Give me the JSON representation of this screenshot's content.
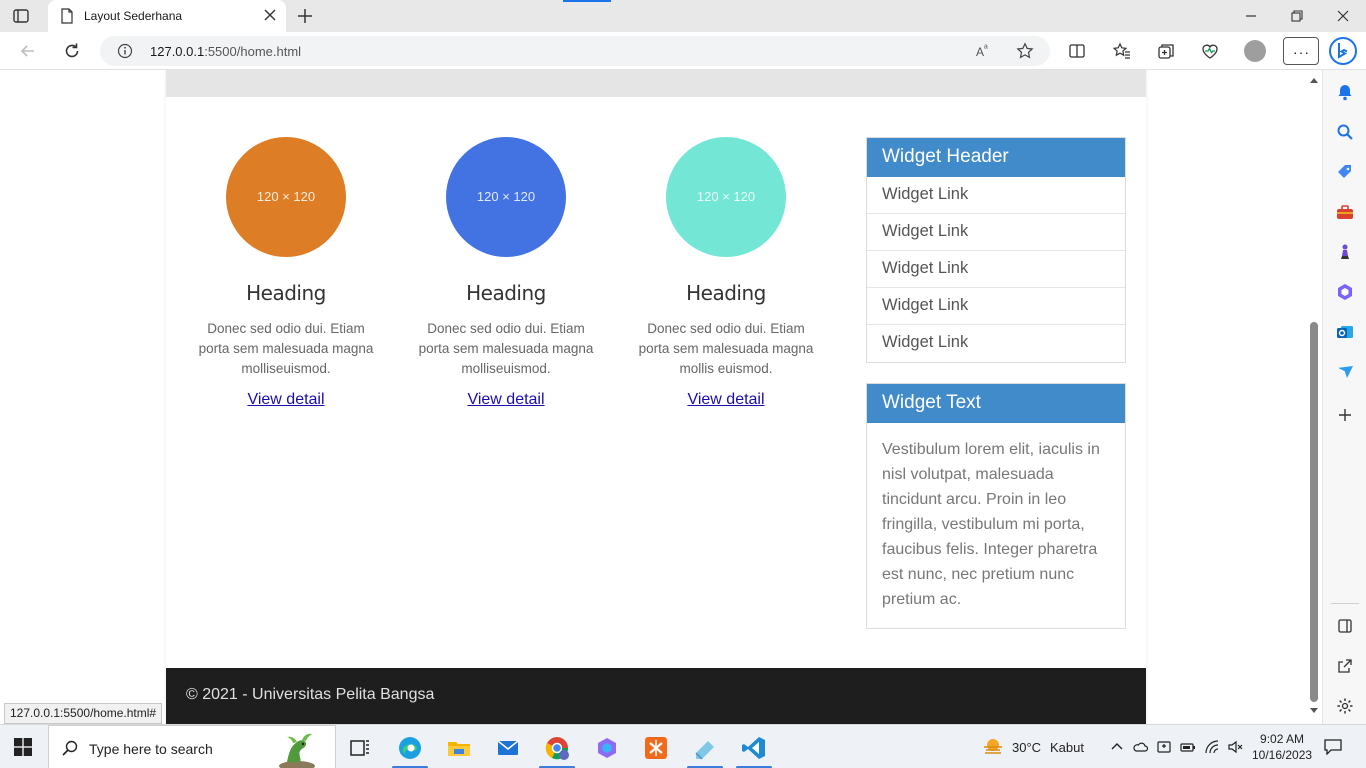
{
  "browser": {
    "tab_title": "Layout Sederhana",
    "url_host": "127.0.0.1",
    "url_rest": ":5500/home.html",
    "status_url": "127.0.0.1:5500/home.html#"
  },
  "page": {
    "cards": [
      {
        "placeholder": "120 × 120",
        "color": "#dd7e26",
        "heading": "Heading",
        "text": "Donec sed odio dui. Etiam porta sem malesuada magna molliseuismod.",
        "link": "View detail"
      },
      {
        "placeholder": "120 × 120",
        "color": "#4373e3",
        "heading": "Heading",
        "text": "Donec sed odio dui. Etiam porta sem malesuada magna molliseuismod.",
        "link": "View detail"
      },
      {
        "placeholder": "120 × 120",
        "color": "#73e6d6",
        "heading": "Heading",
        "text": "Donec sed odio dui. Etiam porta sem malesuada magna mollis euismod.",
        "link": "View detail"
      }
    ],
    "widget_links": {
      "header": "Widget Header",
      "items": [
        "Widget Link",
        "Widget Link",
        "Widget Link",
        "Widget Link",
        "Widget Link"
      ]
    },
    "widget_text": {
      "header": "Widget Text",
      "body": "Vestibulum lorem elit, iaculis in nisl volutpat, malesuada tincidunt arcu. Proin in leo fringilla, vestibulum mi porta, faucibus felis. Integer pharetra est nunc, nec pretium nunc pretium ac."
    },
    "footer": "© 2021 - Universitas Pelita Bangsa"
  },
  "taskbar": {
    "search_placeholder": "Type here to search",
    "temperature": "30°C",
    "weather": "Kabut",
    "time": "9:02 AM",
    "date": "10/16/2023"
  },
  "colors": {
    "widget_header": "#428bca",
    "footer_bg": "#1e1e1e",
    "accent": "#1a73e8"
  }
}
